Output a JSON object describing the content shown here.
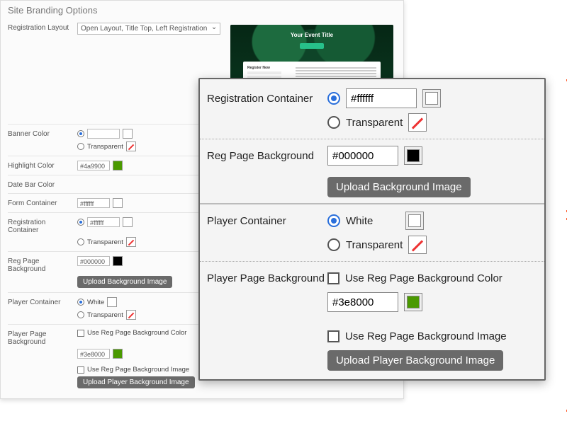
{
  "bg": {
    "title": "Site Branding Options",
    "layout": {
      "label": "Registration Layout",
      "value": "Open Layout, Title Top, Left Registration"
    },
    "preview": {
      "event_title": "Your Event Title",
      "form_title": "Register Now"
    },
    "banner": {
      "label": "Banner Color",
      "transparent_label": "Transparent"
    },
    "highlight": {
      "label": "Highlight Color",
      "value": "#4a9900"
    },
    "datebar": {
      "label": "Date Bar Color"
    },
    "formContainer": {
      "label": "Form Container",
      "value": "#ffffff"
    },
    "regContainer": {
      "label": "Registration Container",
      "value": "#ffffff",
      "transparent_label": "Transparent"
    },
    "regPageBg": {
      "label": "Reg Page Background",
      "value": "#000000",
      "upload_btn": "Upload Background Image"
    },
    "playerContainer": {
      "label": "Player Container",
      "white_label": "White",
      "transparent_label": "Transparent"
    },
    "playerPageBg": {
      "label": "Player Page Background",
      "use_color_label": "Use Reg Page Background Color",
      "value": "#3e8000",
      "use_image_label": "Use Reg Page Background Image",
      "upload_btn": "Upload Player Background Image"
    }
  },
  "fg": {
    "regContainer": {
      "label": "Registration Container",
      "value": "#ffffff",
      "transparent_label": "Transparent"
    },
    "regPageBg": {
      "label": "Reg Page Background",
      "value": "#000000",
      "upload_btn": "Upload Background Image"
    },
    "playerContainer": {
      "label": "Player Container",
      "white_label": "White",
      "transparent_label": "Transparent"
    },
    "playerPageBg": {
      "label": "Player Page Background",
      "use_color_label": "Use Reg Page Background Color",
      "value": "#3e8000",
      "use_image_label": "Use Reg Page Background Image",
      "upload_btn": "Upload Player Background Image"
    }
  }
}
